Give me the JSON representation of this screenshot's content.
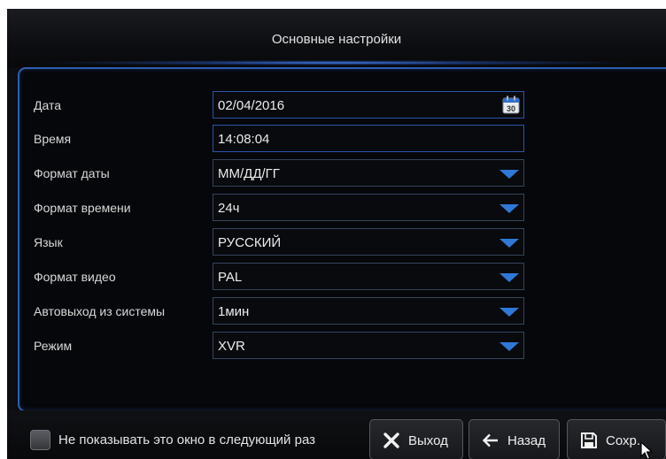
{
  "window": {
    "title": "Основные настройки"
  },
  "settings": {
    "rows": [
      {
        "label": "Дата",
        "value": "02/04/2016",
        "control": "date",
        "icon": "calendar-icon",
        "icon_text": "30"
      },
      {
        "label": "Время",
        "value": "14:08:04",
        "control": "text"
      },
      {
        "label": "Формат даты",
        "value": "ММ/ДД/ГГ",
        "control": "dropdown"
      },
      {
        "label": "Формат времени",
        "value": "24ч",
        "control": "dropdown"
      },
      {
        "label": "Язык",
        "value": "РУССКИЙ",
        "control": "dropdown"
      },
      {
        "label": "Формат видео",
        "value": "PAL",
        "control": "dropdown"
      },
      {
        "label": "Автовыход из системы",
        "value": "1мин",
        "control": "dropdown"
      },
      {
        "label": "Режим",
        "value": "XVR",
        "control": "dropdown"
      }
    ]
  },
  "footer": {
    "dont_show_label": "Не показывать это окно в следующий раз",
    "dont_show_checked": false,
    "buttons": {
      "exit": {
        "label": "Выход",
        "icon": "close-icon"
      },
      "back": {
        "label": "Назад",
        "icon": "arrow-left-icon"
      },
      "save": {
        "label": "Сохр.",
        "icon": "save-icon"
      }
    }
  },
  "colors": {
    "accent": "#2f78d6",
    "panel_border": "#2e5fb0",
    "background": "#0c0d10",
    "text": "#e2e2e2"
  }
}
